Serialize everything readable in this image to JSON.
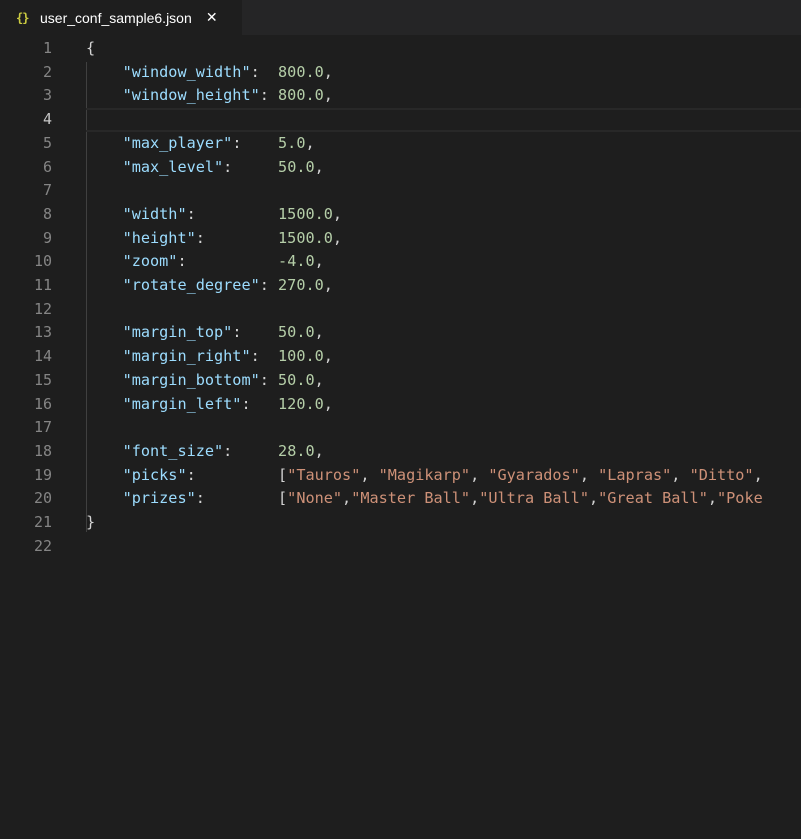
{
  "tab": {
    "icon": "{}",
    "filename": "user_conf_sample6.json",
    "close": "✕"
  },
  "editor": {
    "active_line": 4,
    "lines": [
      {
        "num": "1",
        "tokens": [
          {
            "t": "{",
            "c": "p"
          }
        ]
      },
      {
        "num": "2",
        "tokens": [
          {
            "t": "    ",
            "c": "p"
          },
          {
            "t": "\"window_width\"",
            "c": "k"
          },
          {
            "t": ":  ",
            "c": "p"
          },
          {
            "t": "800.0",
            "c": "n"
          },
          {
            "t": ",",
            "c": "p"
          }
        ]
      },
      {
        "num": "3",
        "tokens": [
          {
            "t": "    ",
            "c": "p"
          },
          {
            "t": "\"window_height\"",
            "c": "k"
          },
          {
            "t": ": ",
            "c": "p"
          },
          {
            "t": "800.0",
            "c": "n"
          },
          {
            "t": ",",
            "c": "p"
          }
        ]
      },
      {
        "num": "4",
        "tokens": []
      },
      {
        "num": "5",
        "tokens": [
          {
            "t": "    ",
            "c": "p"
          },
          {
            "t": "\"max_player\"",
            "c": "k"
          },
          {
            "t": ":    ",
            "c": "p"
          },
          {
            "t": "5.0",
            "c": "n"
          },
          {
            "t": ",",
            "c": "p"
          }
        ]
      },
      {
        "num": "6",
        "tokens": [
          {
            "t": "    ",
            "c": "p"
          },
          {
            "t": "\"max_level\"",
            "c": "k"
          },
          {
            "t": ":     ",
            "c": "p"
          },
          {
            "t": "50.0",
            "c": "n"
          },
          {
            "t": ",",
            "c": "p"
          }
        ]
      },
      {
        "num": "7",
        "tokens": []
      },
      {
        "num": "8",
        "tokens": [
          {
            "t": "    ",
            "c": "p"
          },
          {
            "t": "\"width\"",
            "c": "k"
          },
          {
            "t": ":         ",
            "c": "p"
          },
          {
            "t": "1500.0",
            "c": "n"
          },
          {
            "t": ",",
            "c": "p"
          }
        ]
      },
      {
        "num": "9",
        "tokens": [
          {
            "t": "    ",
            "c": "p"
          },
          {
            "t": "\"height\"",
            "c": "k"
          },
          {
            "t": ":        ",
            "c": "p"
          },
          {
            "t": "1500.0",
            "c": "n"
          },
          {
            "t": ",",
            "c": "p"
          }
        ]
      },
      {
        "num": "10",
        "tokens": [
          {
            "t": "    ",
            "c": "p"
          },
          {
            "t": "\"zoom\"",
            "c": "k"
          },
          {
            "t": ":          ",
            "c": "p"
          },
          {
            "t": "-4.0",
            "c": "n"
          },
          {
            "t": ",",
            "c": "p"
          }
        ]
      },
      {
        "num": "11",
        "tokens": [
          {
            "t": "    ",
            "c": "p"
          },
          {
            "t": "\"rotate_degree\"",
            "c": "k"
          },
          {
            "t": ": ",
            "c": "p"
          },
          {
            "t": "270.0",
            "c": "n"
          },
          {
            "t": ",",
            "c": "p"
          }
        ]
      },
      {
        "num": "12",
        "tokens": []
      },
      {
        "num": "13",
        "tokens": [
          {
            "t": "    ",
            "c": "p"
          },
          {
            "t": "\"margin_top\"",
            "c": "k"
          },
          {
            "t": ":    ",
            "c": "p"
          },
          {
            "t": "50.0",
            "c": "n"
          },
          {
            "t": ",",
            "c": "p"
          }
        ]
      },
      {
        "num": "14",
        "tokens": [
          {
            "t": "    ",
            "c": "p"
          },
          {
            "t": "\"margin_right\"",
            "c": "k"
          },
          {
            "t": ":  ",
            "c": "p"
          },
          {
            "t": "100.0",
            "c": "n"
          },
          {
            "t": ",",
            "c": "p"
          }
        ]
      },
      {
        "num": "15",
        "tokens": [
          {
            "t": "    ",
            "c": "p"
          },
          {
            "t": "\"margin_bottom\"",
            "c": "k"
          },
          {
            "t": ": ",
            "c": "p"
          },
          {
            "t": "50.0",
            "c": "n"
          },
          {
            "t": ",",
            "c": "p"
          }
        ]
      },
      {
        "num": "16",
        "tokens": [
          {
            "t": "    ",
            "c": "p"
          },
          {
            "t": "\"margin_left\"",
            "c": "k"
          },
          {
            "t": ":   ",
            "c": "p"
          },
          {
            "t": "120.0",
            "c": "n"
          },
          {
            "t": ",",
            "c": "p"
          }
        ]
      },
      {
        "num": "17",
        "tokens": []
      },
      {
        "num": "18",
        "tokens": [
          {
            "t": "    ",
            "c": "p"
          },
          {
            "t": "\"font_size\"",
            "c": "k"
          },
          {
            "t": ":     ",
            "c": "p"
          },
          {
            "t": "28.0",
            "c": "n"
          },
          {
            "t": ",",
            "c": "p"
          }
        ]
      },
      {
        "num": "19",
        "tokens": [
          {
            "t": "    ",
            "c": "p"
          },
          {
            "t": "\"picks\"",
            "c": "k"
          },
          {
            "t": ":         [",
            "c": "p"
          },
          {
            "t": "\"Tauros\"",
            "c": "s"
          },
          {
            "t": ", ",
            "c": "p"
          },
          {
            "t": "\"Magikarp\"",
            "c": "s"
          },
          {
            "t": ", ",
            "c": "p"
          },
          {
            "t": "\"Gyarados\"",
            "c": "s"
          },
          {
            "t": ", ",
            "c": "p"
          },
          {
            "t": "\"Lapras\"",
            "c": "s"
          },
          {
            "t": ", ",
            "c": "p"
          },
          {
            "t": "\"Ditto\"",
            "c": "s"
          },
          {
            "t": ", ",
            "c": "p"
          }
        ]
      },
      {
        "num": "20",
        "tokens": [
          {
            "t": "    ",
            "c": "p"
          },
          {
            "t": "\"prizes\"",
            "c": "k"
          },
          {
            "t": ":        [",
            "c": "p"
          },
          {
            "t": "\"None\"",
            "c": "s"
          },
          {
            "t": ",",
            "c": "p"
          },
          {
            "t": "\"Master Ball\"",
            "c": "s"
          },
          {
            "t": ",",
            "c": "p"
          },
          {
            "t": "\"Ultra Ball\"",
            "c": "s"
          },
          {
            "t": ",",
            "c": "p"
          },
          {
            "t": "\"Great Ball\"",
            "c": "s"
          },
          {
            "t": ",",
            "c": "p"
          },
          {
            "t": "\"Poke",
            "c": "s"
          }
        ]
      },
      {
        "num": "21",
        "tokens": [
          {
            "t": "}",
            "c": "p"
          }
        ]
      },
      {
        "num": "22",
        "tokens": []
      }
    ]
  },
  "colors": {
    "background": "#1e1e1e",
    "key": "#9cdcfe",
    "number": "#b5cea8",
    "string": "#ce9178",
    "punctuation": "#d4d4d4",
    "line_number": "#858585"
  }
}
